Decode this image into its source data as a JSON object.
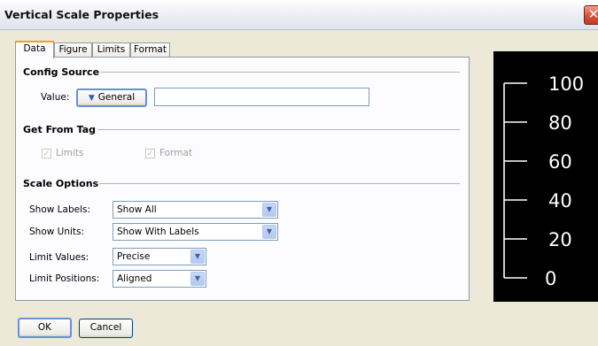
{
  "window": {
    "title": "Vertical Scale Properties",
    "close_glyph": "✕"
  },
  "tabs": [
    {
      "label": "Data",
      "active": true
    },
    {
      "label": "Figure",
      "active": false
    },
    {
      "label": "Limits",
      "active": false
    },
    {
      "label": "Format",
      "active": false
    }
  ],
  "config_source": {
    "heading": "Config Source",
    "value_label": "Value:",
    "button_label": "General",
    "text_value": ""
  },
  "get_from_tag": {
    "heading": "Get From Tag",
    "limits": {
      "label": "Limits",
      "checked": true
    },
    "format": {
      "label": "Format",
      "checked": true
    }
  },
  "scale_options": {
    "heading": "Scale Options",
    "show_labels": {
      "label": "Show Labels:",
      "value": "Show All"
    },
    "show_units": {
      "label": "Show Units:",
      "value": "Show With Labels"
    },
    "limit_values": {
      "label": "Limit Values:",
      "value": "Precise"
    },
    "limit_positions": {
      "label": "Limit Positions:",
      "value": "Aligned"
    }
  },
  "preview": {
    "ticks": [
      "100",
      "80",
      "60",
      "40",
      "20",
      "0"
    ],
    "background": "#000000",
    "foreground": "#ffffff"
  },
  "buttons": {
    "ok": "OK",
    "cancel": "Cancel"
  }
}
